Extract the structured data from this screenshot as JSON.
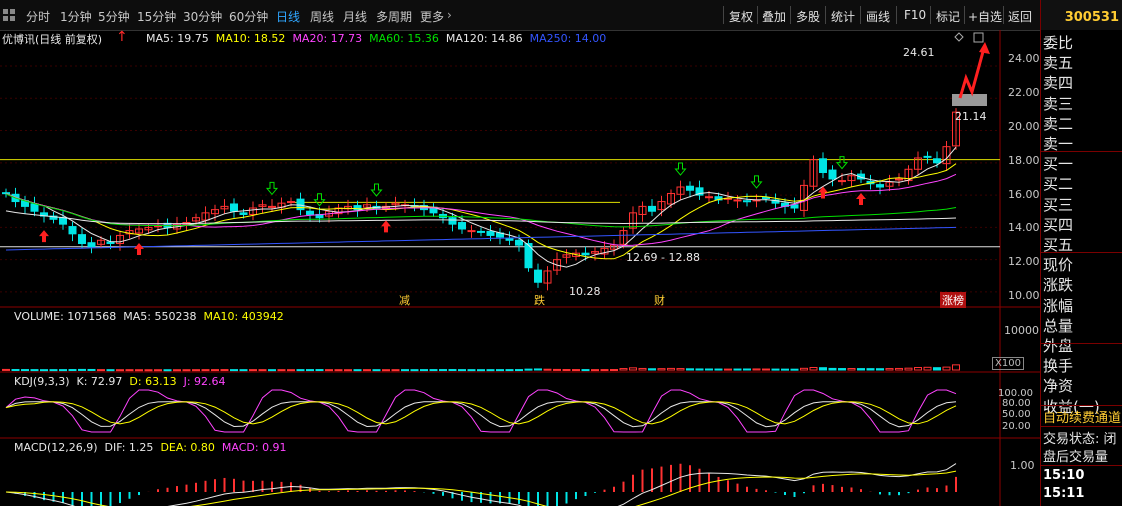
{
  "toolbar": {
    "tabs": [
      "分时",
      "1分钟",
      "5分钟",
      "15分钟",
      "30分钟",
      "60分钟",
      "日线",
      "周线",
      "月线",
      "多周期",
      "更多"
    ],
    "active_tab": "日线",
    "right_buttons": [
      "复权",
      "叠加",
      "多股",
      "统计",
      "画线",
      "F10",
      "标记",
      "+自选",
      "返回"
    ]
  },
  "stock_code": "300531",
  "ma_header": {
    "name": "优博讯(日线 前复权)",
    "items": [
      {
        "label": "MA5: 19.75",
        "color": "#e8e8e8"
      },
      {
        "label": "MA10: 18.52",
        "color": "#ffff00"
      },
      {
        "label": "MA20: 17.73",
        "color": "#ff44ff"
      },
      {
        "label": "MA60: 15.36",
        "color": "#00e000"
      },
      {
        "label": "MA120: 14.86",
        "color": "#e8e8e8"
      },
      {
        "label": "MA250: 14.00",
        "color": "#3355ff"
      }
    ]
  },
  "vol_header": [
    {
      "label": "VOLUME: 1071568",
      "color": "#e8e8e8"
    },
    {
      "label": "MA5: 550238",
      "color": "#e8e8e8"
    },
    {
      "label": "MA10: 403942",
      "color": "#ffff00"
    }
  ],
  "kdj_header": [
    {
      "label": "KDJ(9,3,3)",
      "color": "#e8e8e8"
    },
    {
      "label": "K: 72.97",
      "color": "#e8e8e8"
    },
    {
      "label": "D: 63.13",
      "color": "#ffff00"
    },
    {
      "label": "J: 92.64",
      "color": "#ff44ff"
    }
  ],
  "macd_header": [
    {
      "label": "MACD(12,26,9)",
      "color": "#e8e8e8"
    },
    {
      "label": "DIF: 1.25",
      "color": "#e8e8e8"
    },
    {
      "label": "DEA: 0.80",
      "color": "#ffff00"
    },
    {
      "label": "MACD: 0.91",
      "color": "#ff44ff"
    }
  ],
  "price_axis": [
    "24.00",
    "22.00",
    "20.00",
    "18.00",
    "16.00",
    "14.00",
    "12.00",
    "10.00"
  ],
  "volume_axis": [
    "10000",
    "X100"
  ],
  "kdj_axis": [
    "100.00",
    "80.00",
    "50.00",
    "20.00"
  ],
  "macd_axis": [
    "1.00"
  ],
  "annotations": {
    "high": "24.61",
    "current": "21.14",
    "range": "12.69 - 12.88",
    "low": "10.28",
    "labels": [
      "减",
      "跌",
      "财",
      "涨榜"
    ]
  },
  "side_panel": {
    "rows": [
      "委比",
      "卖五",
      "卖四",
      "卖三",
      "卖二",
      "卖一",
      "买一",
      "买二",
      "买三",
      "买四",
      "买五",
      "现价",
      "涨跌",
      "涨幅",
      "总量",
      "外盘",
      "换手",
      "净资",
      "收益(一)"
    ],
    "promo": "自动续费通道",
    "status_rows": [
      "交易状态: 闭",
      "盘后交易量"
    ],
    "times": [
      "15:10",
      "15:11"
    ]
  },
  "chart_data": {
    "type": "candlestick",
    "price_range": [
      9.5,
      25.3
    ],
    "closes": [
      16.1,
      15.6,
      15.3,
      15.0,
      14.7,
      14.5,
      14.2,
      13.6,
      13.0,
      12.8,
      13.2,
      13.0,
      13.5,
      13.8,
      13.9,
      14.0,
      14.1,
      14.0,
      14.2,
      14.3,
      14.6,
      14.9,
      15.1,
      15.3,
      15.0,
      14.8,
      15.2,
      15.4,
      15.3,
      15.5,
      15.6,
      15.1,
      14.8,
      14.6,
      15.0,
      15.2,
      15.3,
      15.1,
      15.4,
      15.2,
      15.3,
      15.5,
      15.4,
      15.3,
      15.1,
      14.9,
      14.6,
      14.2,
      13.9,
      13.8,
      13.7,
      13.5,
      13.4,
      13.2,
      12.9,
      11.5,
      10.6,
      11.3,
      12.0,
      12.3,
      12.4,
      12.3,
      12.5,
      12.7,
      12.9,
      13.8,
      14.9,
      15.3,
      15.0,
      15.6,
      16.1,
      16.5,
      16.3,
      16.0,
      15.9,
      15.7,
      15.8,
      15.7,
      15.6,
      15.7,
      15.8,
      15.5,
      15.3,
      15.2,
      16.6,
      18.2,
      17.4,
      17.0,
      16.9,
      17.2,
      17.0,
      16.7,
      16.5,
      16.8,
      17.0,
      17.6,
      18.3,
      18.4,
      18.0,
      19.0,
      21.14
    ],
    "volume_scale_x100": [
      0,
      10000
    ],
    "volume": [
      120,
      100,
      90,
      80,
      70,
      75,
      80,
      95,
      120,
      110,
      80,
      70,
      65,
      70,
      60,
      55,
      60,
      55,
      60,
      65,
      70,
      80,
      85,
      90,
      75,
      70,
      80,
      75,
      70,
      75,
      70,
      80,
      85,
      90,
      75,
      70,
      65,
      70,
      75,
      70,
      65,
      70,
      75,
      70,
      80,
      85,
      90,
      95,
      80,
      75,
      70,
      75,
      80,
      85,
      90,
      180,
      220,
      160,
      120,
      100,
      90,
      85,
      80,
      90,
      100,
      300,
      450,
      320,
      260,
      280,
      330,
      300,
      250,
      220,
      210,
      200,
      190,
      200,
      210,
      220,
      200,
      190,
      180,
      170,
      350,
      520,
      480,
      330,
      300,
      310,
      290,
      280,
      270,
      300,
      320,
      380,
      520,
      560,
      480,
      600,
      1071
    ],
    "kdj": {
      "K": 72.97,
      "D": 63.13,
      "J": 92.64
    },
    "macd": {
      "DIF": 1.25,
      "DEA": 0.8,
      "MACD": 0.91
    }
  }
}
